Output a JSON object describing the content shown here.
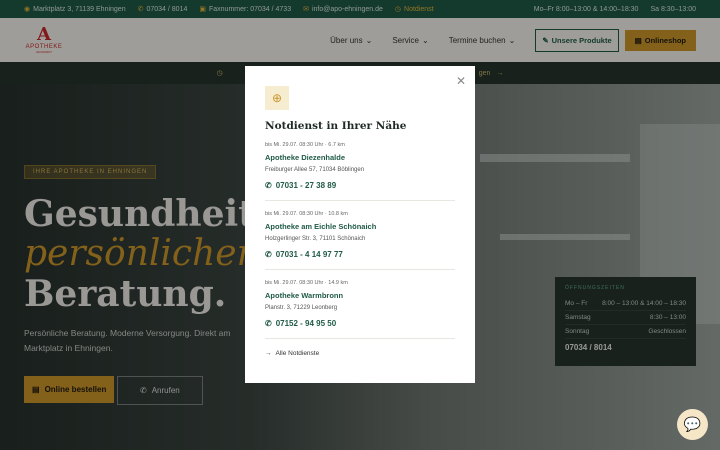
{
  "topbar": {
    "address": "Marktplatz 3, 71139 Ehningen",
    "phone": "07034 / 8014",
    "fax": "Faxnummer: 07034 / 4733",
    "email": "info@apo-ehningen.de",
    "notdienst": "Notdienst",
    "hours_weekday": "Mo–Fr 8:00–13:00 & 14:00–18:30",
    "hours_saturday": "Sa 8:30–13:00"
  },
  "header": {
    "logo_mark": "A",
    "logo_text": "APOTHEKE",
    "logo_sub": "AM MARKT",
    "nav": [
      {
        "label": "Über uns"
      },
      {
        "label": "Service"
      },
      {
        "label": "Termine buchen"
      }
    ],
    "btn_produkte": "Unsere Produkte",
    "btn_shop": "Onlineshop"
  },
  "infostrip": {
    "text": "gen"
  },
  "hero": {
    "tag": "IHRE APOTHEKE IN EHNINGEN",
    "line1": "Gesundheit m",
    "line2": "persönlicher",
    "line3": "Beratung.",
    "sub": "Persönliche Beratung. Moderne Versorgung. Direkt am Marktplatz in Ehningen.",
    "btn_order": "Online bestellen",
    "btn_call": "Anrufen"
  },
  "hours": {
    "title": "ÖFFNUNGSZEITEN",
    "rows": [
      {
        "day": "Mo – Fr",
        "time": "8:00 – 13:00 & 14:00 – 18:30"
      },
      {
        "day": "Samstag",
        "time": "8:30 – 13:00"
      },
      {
        "day": "Sonntag",
        "time": "Geschlossen"
      }
    ],
    "phone": "07034 / 8014"
  },
  "modal": {
    "title": "Notdienst in Ihrer Nähe",
    "entries": [
      {
        "meta": "bis Mi. 29.07. 08:30 Uhr · 6.7 km",
        "name": "Apotheke Diezenhalde",
        "addr": "Freiburger Allee 57, 71034 Böblingen",
        "tel": "07031 - 27 38 89"
      },
      {
        "meta": "bis Mi. 29.07. 08:30 Uhr · 10.8 km",
        "name": "Apotheke am Eichle Schönaich",
        "addr": "Holzgerlinger Str. 3, 71101 Schönaich",
        "tel": "07031 - 4 14 97 77"
      },
      {
        "meta": "bis Mi. 29.07. 08:30 Uhr · 14.9 km",
        "name": "Apotheke Warmbronn",
        "addr": "Planstr. 3, 71229 Leonberg",
        "tel": "07152 - 94 95 50"
      }
    ],
    "all_link": "Alle Notdienste"
  },
  "colors": {
    "brand_green": "#1f5a45",
    "accent_gold": "#c9962a",
    "logo_red": "#c62828"
  },
  "icons": [
    "pin-icon",
    "phone-icon",
    "fax-icon",
    "mail-icon",
    "clock-icon",
    "chevron-down-icon",
    "close-icon",
    "plus-circle-icon",
    "arrow-right-icon",
    "chat-icon"
  ]
}
